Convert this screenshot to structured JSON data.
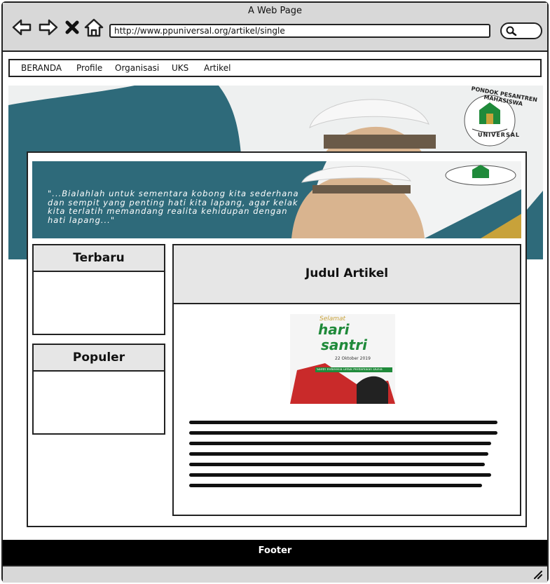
{
  "window": {
    "title": "A Web Page"
  },
  "browser": {
    "url": "http://www.ppuniversal.org/artikel/single"
  },
  "nav": {
    "items": [
      "BERANDA",
      "Profile",
      "Organisasi",
      "UKS",
      "Artikel"
    ]
  },
  "banner": {
    "logo_text_top": "PONDOK PESANTREN MAHASISWA",
    "logo_text_bottom": "UNIVERSAL",
    "quote": "\"...Bialahlah untuk sementara kobong kita sederhana dan sempit yang penting hati kita lapang, agar kelak kita terlatih memandang realita kehidupan dengan hati lapang...\""
  },
  "sidebar": {
    "terbaru_title": "Terbaru",
    "populer_title": "Populer"
  },
  "article": {
    "title": "Judul Artikel",
    "poster": {
      "selamat": "Selamat",
      "hari": "hari",
      "santri": "santri",
      "date": "22 Oktober 2019",
      "tagline": "Santri Indonesia untuk Perdamaian Dunia"
    }
  },
  "footer": {
    "label": "Footer"
  },
  "colors": {
    "teal": "#2e6a7a",
    "green": "#1f8a3a",
    "gold": "#c8a23a",
    "footer_bg": "#000000"
  }
}
